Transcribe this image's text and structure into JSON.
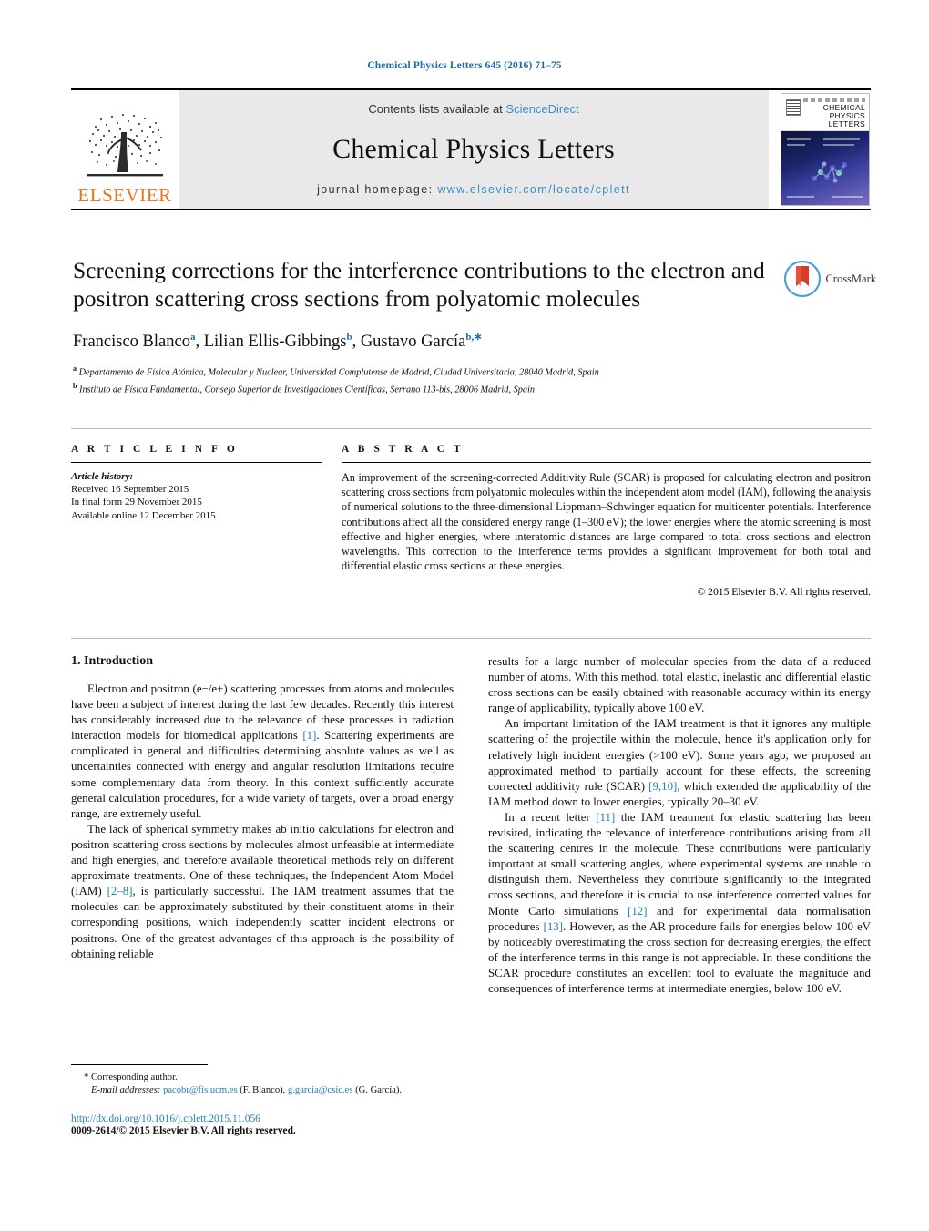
{
  "running_head": "Chemical Physics Letters 645 (2016) 71–75",
  "masthead": {
    "contents_prefix": "Contents lists available at ",
    "sciencedirect": "ScienceDirect",
    "journal_title": "Chemical Physics Letters",
    "homepage_prefix": "journal homepage: ",
    "homepage_url": "www.elsevier.com/locate/cplett",
    "publisher": "ELSEVIER",
    "cover_title_line1": "CHEMICAL",
    "cover_title_line2": "PHYSICS",
    "cover_title_line3": "LETTERS",
    "link_color": "#3d8dc4",
    "brand_color": "#E87722"
  },
  "article": {
    "title": "Screening corrections for the interference contributions to the electron and positron scattering cross sections from polyatomic molecules",
    "authors": [
      {
        "name": "Francisco Blanco",
        "marks": "a"
      },
      {
        "name": "Lilian Ellis-Gibbings",
        "marks": "b"
      },
      {
        "name": "Gustavo García",
        "marks": "b,∗"
      }
    ],
    "affiliations": [
      {
        "mark": "a",
        "text": "Departamento de Física Atómica, Molecular y Nuclear, Universidad Complutense de Madrid, Ciudad Universitaria, 28040 Madrid, Spain"
      },
      {
        "mark": "b",
        "text": "Instituto de Física Fundamental, Consejo Superior de Investigaciones Científicas, Serrano 113-bis, 28006 Madrid, Spain"
      }
    ],
    "crossmark_label": "CrossMark"
  },
  "article_info": {
    "heading": "A R T I C L E   I N F O",
    "history_label": "Article history:",
    "history_lines": [
      "Received 16 September 2015",
      "In final form 29 November 2015",
      "Available online 12 December 2015"
    ]
  },
  "abstract": {
    "heading": "A B S T R A C T",
    "text": "An improvement of the screening-corrected Additivity Rule (SCAR) is proposed for calculating electron and positron scattering cross sections from polyatomic molecules within the independent atom model (IAM), following the analysis of numerical solutions to the three-dimensional Lippmann–Schwinger equation for multicenter potentials. Interference contributions affect all the considered energy range (1–300 eV); the lower energies where the atomic screening is most effective and higher energies, where interatomic distances are large compared to total cross sections and electron wavelengths. This correction to the interference terms provides a significant improvement for both total and differential elastic cross sections at these energies.",
    "copyright": "© 2015 Elsevier B.V. All rights reserved."
  },
  "introduction": {
    "heading": "1.  Introduction",
    "left_paragraphs": [
      "Electron and positron (e−/e+) scattering processes from atoms and molecules have been a subject of interest during the last few decades. Recently this interest has considerably increased due to the relevance of these processes in radiation interaction models for biomedical applications [1]. Scattering experiments are complicated in general and difficulties determining absolute values as well as uncertainties connected with energy and angular resolution limitations require some complementary data from theory. In this context sufficiently accurate general calculation procedures, for a wide variety of targets, over a broad energy range, are extremely useful.",
      "The lack of spherical symmetry makes ab initio calculations for electron and positron scattering cross sections by molecules almost unfeasible at intermediate and high energies, and therefore available theoretical methods rely on different approximate treatments. One of these techniques, the Independent Atom Model (IAM) [2–8], is particularly successful. The IAM treatment assumes that the molecules can be approximately substituted by their constituent atoms in their corresponding positions, which independently scatter incident electrons or positrons. One of the greatest advantages of this approach is the possibility of obtaining reliable"
    ],
    "right_paragraphs": [
      "results for a large number of molecular species from the data of a reduced number of atoms. With this method, total elastic, inelastic and differential elastic cross sections can be easily obtained with reasonable accuracy within its energy range of applicability, typically above 100 eV.",
      "An important limitation of the IAM treatment is that it ignores any multiple scattering of the projectile within the molecule, hence it's application only for relatively high incident energies (>100 eV). Some years ago, we proposed an approximated method to partially account for these effects, the screening corrected additivity rule (SCAR) [9,10], which extended the applicability of the IAM method down to lower energies, typically 20–30 eV.",
      "In a recent letter [11] the IAM treatment for elastic scattering has been revisited, indicating the relevance of interference contributions arising from all the scattering centres in the molecule. These contributions were particularly important at small scattering angles, where experimental systems are unable to distinguish them. Nevertheless they contribute significantly to the integrated cross sections, and therefore it is crucial to use interference corrected values for Monte Carlo simulations [12] and for experimental data normalisation procedures [13]. However, as the AR procedure fails for energies below 100 eV by noticeably overestimating the cross section for decreasing energies, the effect of the interference terms in this range is not appreciable. In these conditions the SCAR procedure constitutes an excellent tool to evaluate the magnitude and consequences of interference terms at intermediate energies, below 100 eV."
    ]
  },
  "footnotes": {
    "corresponding": "* Corresponding author.",
    "email_label": "E-mail addresses:",
    "email1": "pacobr@fis.ucm.es",
    "email1_owner": " (F. Blanco), ",
    "email2": "g.garcia@csic.es",
    "email2_owner": " (G. García)."
  },
  "footer": {
    "doi": "http://dx.doi.org/10.1016/j.cplett.2015.11.056",
    "issn_line": "0009-2614/© 2015 Elsevier B.V. All rights reserved."
  }
}
